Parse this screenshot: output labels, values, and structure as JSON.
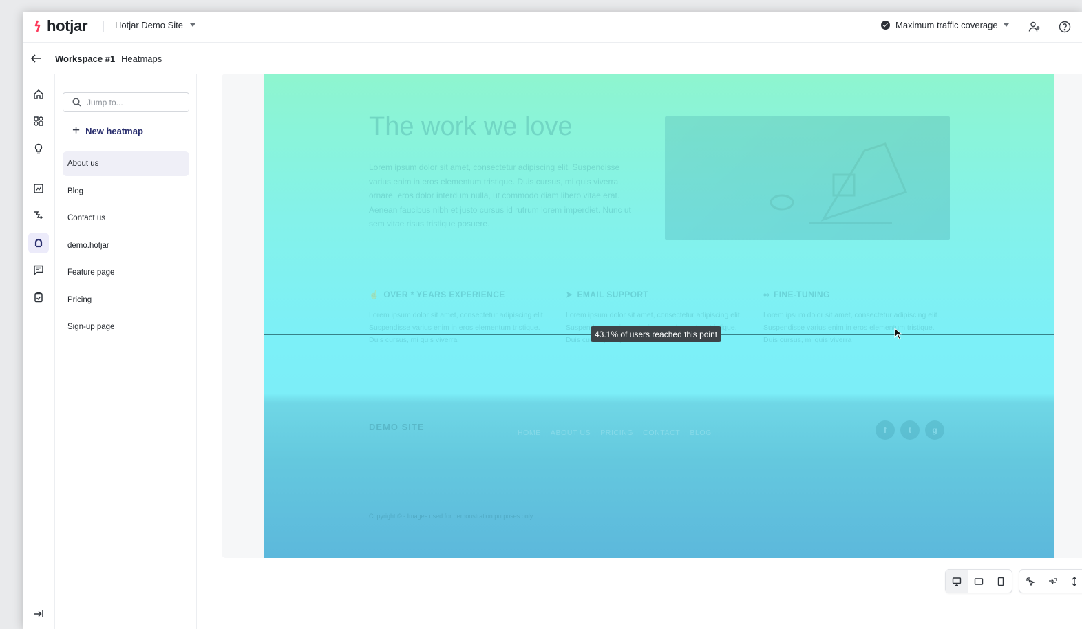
{
  "app": {
    "logo_text": "hotjar",
    "site_name": "Hotjar Demo Site",
    "coverage_label": "Maximum traffic coverage"
  },
  "breadcrumb": {
    "workspace": "Workspace #1",
    "section": "Heatmaps"
  },
  "rail": {
    "icons": [
      "home-icon",
      "dashboards-icon",
      "lightbulb-icon",
      "trends-icon",
      "funnels-icon",
      "heatmaps-icon",
      "feedback-icon",
      "surveys-icon"
    ],
    "active": "heatmaps-icon"
  },
  "panel": {
    "search_placeholder": "Jump to...",
    "new_heatmap_label": "New heatmap",
    "items": [
      {
        "label": "About us"
      },
      {
        "label": "Blog"
      },
      {
        "label": "Contact us"
      },
      {
        "label": "demo.hotjar"
      },
      {
        "label": "Feature page"
      },
      {
        "label": "Pricing"
      },
      {
        "label": "Sign-up page"
      }
    ],
    "selected_index": 0
  },
  "preview": {
    "site_title": "The work we love",
    "site_paragraph": "Lorem ipsum dolor sit amet, consectetur adipiscing elit. Suspendisse varius enim in eros elementum tristique. Duis cursus, mi quis viverra ornare, eros dolor interdum nulla, ut commodo diam libero vitae erat. Aenean faucibus nibh et justo cursus id rutrum lorem imperdiet. Nunc ut sem vitae risus tristique posuere.",
    "features": [
      {
        "title": "OVER * YEARS EXPERIENCE",
        "text": "Lorem ipsum dolor sit amet, consectetur adipiscing elit. Suspendisse varius enim in eros elementum tristique. Duis cursus, mi quis viverra"
      },
      {
        "title": "EMAIL SUPPORT",
        "text": "Lorem ipsum dolor sit amet, consectetur adipiscing elit. Suspendisse varius enim in eros elementum tristique. Duis cursus, mi quis viverra"
      },
      {
        "title": "FINE-TUNING",
        "text": "Lorem ipsum dolor sit amet, consectetur adipiscing elit. Suspendisse varius enim in eros elementum tristique. Duis cursus, mi quis viverra"
      }
    ],
    "footer_brand": "DEMO SITE",
    "footer_nav": [
      "HOME",
      "ABOUT US",
      "PRICING",
      "CONTACT",
      "BLOG"
    ],
    "footer_social": [
      "f",
      "t",
      "g"
    ],
    "footer_copy": "Copyright © - Images used for demonstration purposes only"
  },
  "scroll_marker": {
    "label": "43.1% of users reached this point"
  },
  "toolbar": {
    "device_tools": [
      "desktop-icon",
      "tablet-icon",
      "mobile-icon"
    ],
    "map_tools": [
      "click-map-icon",
      "move-map-icon",
      "scroll-map-icon"
    ]
  },
  "colors": {
    "heatmap_top": "#8ef5cf",
    "heatmap_mid": "#7cf0f8",
    "heatmap_bottom": "#5cb8dc",
    "brand_accent": "#fd3a5c",
    "active_nav": "#2a2f6e"
  }
}
